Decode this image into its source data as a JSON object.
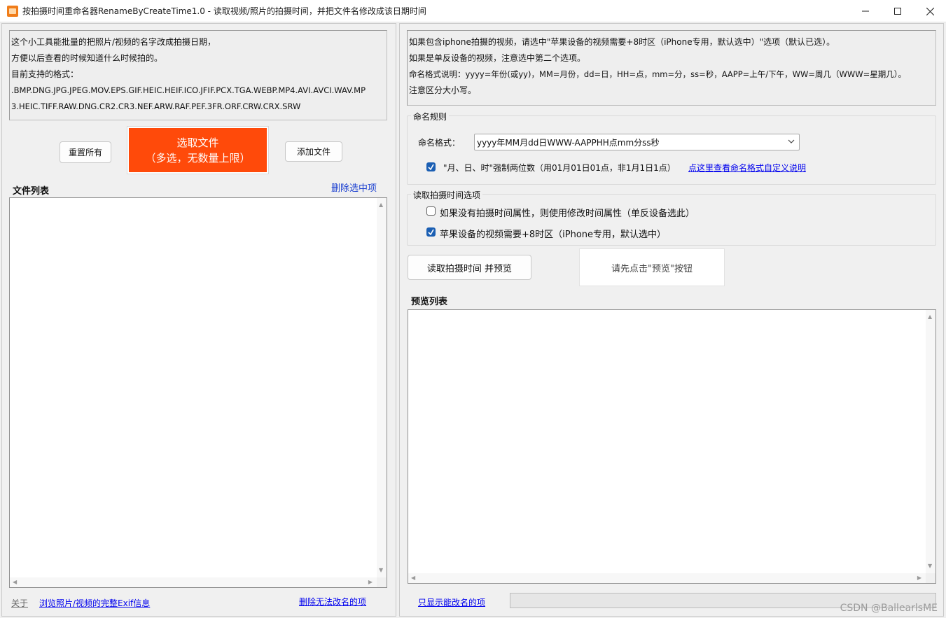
{
  "window": {
    "title": "按拍摄时间重命名器RenameByCreateTime1.0 - 读取视频/照片的拍摄时间，并把文件名修改成该日期时间",
    "app_icon": "camera-app-icon",
    "controls": [
      "minimize-icon",
      "maximize-icon",
      "close-icon"
    ]
  },
  "left": {
    "info_lines": [
      "这个小工具能批量的把照片/视频的名字改成拍摄日期，",
      "方便以后查看的时候知道什么时候拍的。",
      "目前支持的格式：",
      ".BMP.DNG.JPG.JPEG.MOV.EPS.GIF.HEIC.HEIF.ICO.JFIF.PCX.TGA.WEBP.MP4.AVI.AVCI.WAV.MP",
      "3.HEIC.TIFF.RAW.DNG.CR2.CR3.NEF.ARW.RAF.PEF.3FR.ORF.CRW.CRX.SRW"
    ],
    "reset_button": "重置所有",
    "select_button_line1": "选取文件",
    "select_button_line2": "（多选，无数量上限）",
    "add_button": "添加文件",
    "file_list_title": "文件列表",
    "delete_selected_link": "删除选中项",
    "about_link": "关于",
    "browse_exif_link": "浏览照片/视频的完整Exif信息",
    "delete_unrenamable_link": "删除无法改名的项"
  },
  "right": {
    "info_lines": [
      "如果包含iphone拍摄的视频，请选中\"苹果设备的视频需要+8时区（iPhone专用，默认选中）\"选项（默认已选）。",
      "如果是单反设备的视频，注意选中第二个选项。",
      "命名格式说明：yyyy=年份(或yy)，MM=月份，dd=日，HH=点，mm=分，ss=秒，AAPP=上午/下午，WW=周几（WWW=星期几）。",
      "注意区分大小写。"
    ],
    "naming_group": {
      "legend": "命名规则",
      "format_label": "命名格式：",
      "format_value": "yyyy年MM月dd日WWW-AAPPHH点mm分ss秒",
      "force_two_digit": {
        "label": "\"月、日、时\"强制两位数（用01月01日01点，非1月1日1点）",
        "checked": true
      },
      "custom_help_link": "点这里查看命名格式自定义说明"
    },
    "read_group": {
      "legend": "读取拍摄时间选项",
      "option1": {
        "label": "如果没有拍摄时间属性，则使用修改时间属性（单反设备选此）",
        "checked": false
      },
      "option2": {
        "label": "苹果设备的视频需要+8时区（iPhone专用，默认选中）",
        "checked": true
      }
    },
    "read_preview_button": "读取拍摄时间 并预览",
    "status_text": "请先点击\"预览\"按钮",
    "preview_list_title": "预览列表",
    "only_renamable_link": "只显示能改名的项",
    "progress_value": 0
  },
  "watermark": "CSDN @BallearlsME",
  "colors": {
    "accent_orange": "#ff4a0a",
    "link_blue": "#0000ee",
    "checkbox_blue": "#1b5fb3"
  }
}
